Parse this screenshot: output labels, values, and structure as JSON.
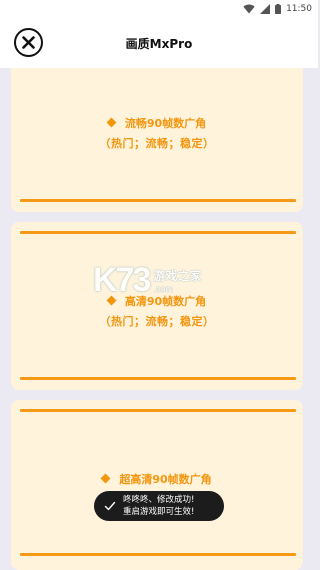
{
  "status_bar": {
    "time": "11:50",
    "icons": [
      "wifi-icon",
      "signal-icon",
      "battery-icon"
    ]
  },
  "header": {
    "title": "画质MxPro",
    "close_icon": "close-icon"
  },
  "options": [
    {
      "label": "流畅90帧数广角",
      "tags": "（热门；流畅；稳定）"
    },
    {
      "label": "高清90帧数广角",
      "tags": "（热门；流畅；稳定）"
    },
    {
      "label": "超高清90帧数广角"
    }
  ],
  "watermark": {
    "logo": "K73",
    "text": "游戏之家",
    "url": ".com"
  },
  "toast": {
    "line1": "咚咚咚、修改成功!",
    "line2": "重启游戏即可生效!"
  },
  "colors": {
    "accent": "#f3960f",
    "card_bg": "#fff3dc",
    "page_bg": "#ebeaf2",
    "toast_bg": "#1c1c1c"
  }
}
